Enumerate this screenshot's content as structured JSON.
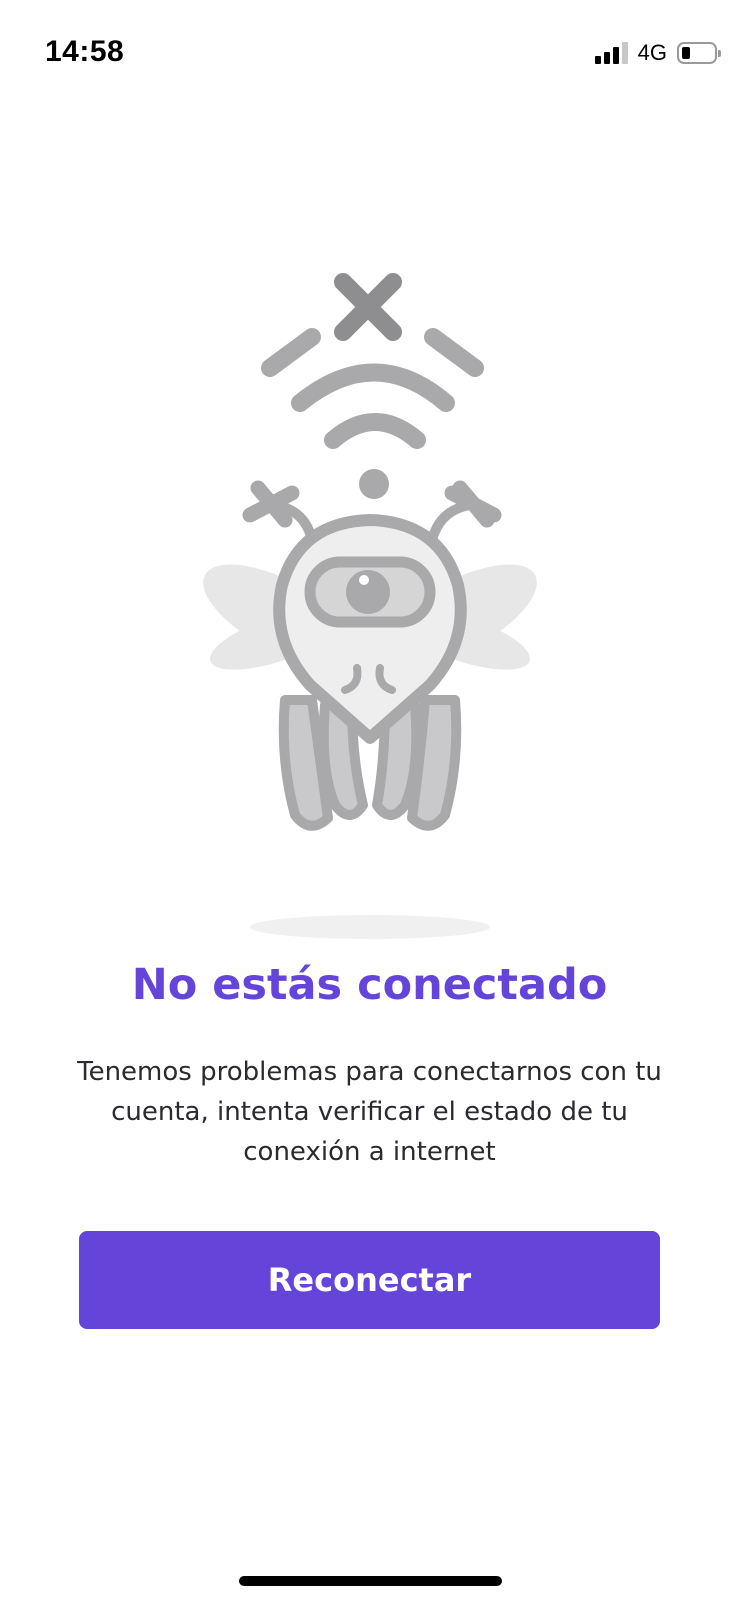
{
  "status_bar": {
    "time": "14:58",
    "network": "4G",
    "signal_bars_active": 3,
    "signal_bars_total": 4,
    "battery_level": 0.2
  },
  "illustration": {
    "icon": "disconnected-bee-robot-icon",
    "colors": {
      "stroke": "#a9a9ab",
      "fill": "#e2e2e3",
      "cross": "#8e8e90",
      "wing": "#e6e6e7"
    }
  },
  "content": {
    "title": "No estás conectado",
    "message": "Tenemos problemas para conectarnos con tu cuenta, intenta verificar el estado de tu conexión a internet",
    "button_label": "Reconectar"
  },
  "colors": {
    "accent": "#6544d9",
    "text": "#2a2a30",
    "background": "#ffffff"
  }
}
